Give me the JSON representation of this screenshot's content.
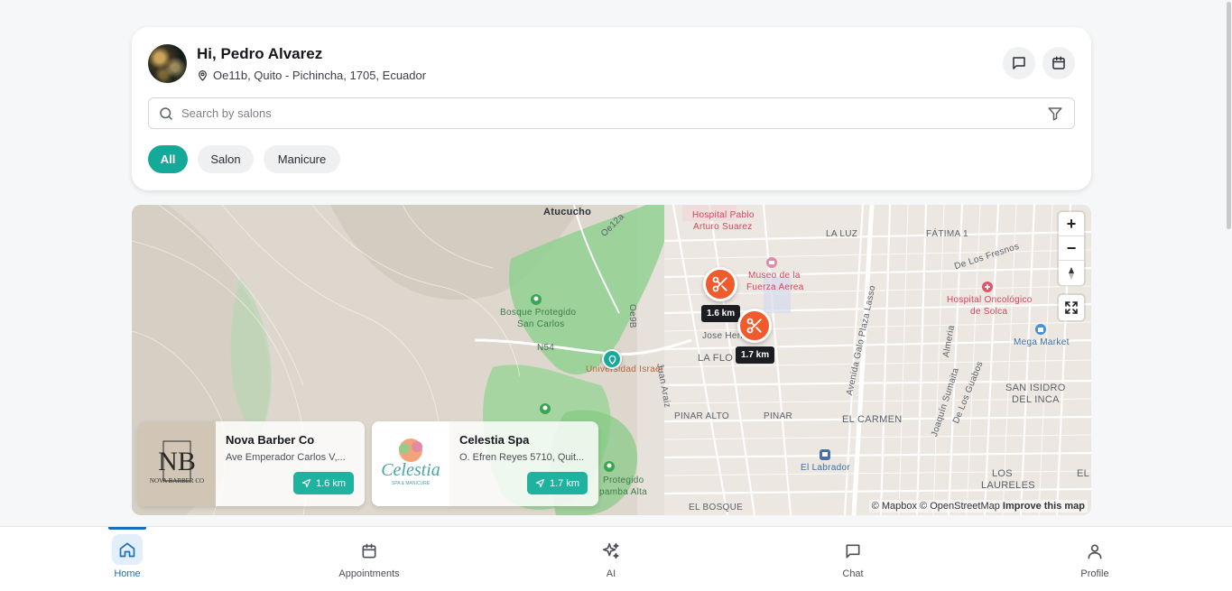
{
  "header": {
    "greeting": "Hi, Pedro Alvarez",
    "location": "Oe11b, Quito - Pichincha, 1705, Ecuador",
    "avatar_icon": "avatar",
    "messages_icon": "message-square-icon",
    "calendar_icon": "calendar-icon"
  },
  "search": {
    "placeholder": "Search by salons",
    "value": ""
  },
  "filters": {
    "chips": [
      {
        "label": "All",
        "active": true
      },
      {
        "label": "Salon",
        "active": false
      },
      {
        "label": "Manicure",
        "active": false
      }
    ]
  },
  "map": {
    "labels": {
      "atucucho": "Atucucho",
      "hospital_pablo_1": "Hospital Pablo",
      "hospital_pablo_2": "Arturo Suarez",
      "la_luz": "LA LUZ",
      "fatima": "FÁTIMA 1",
      "de_los_fresnos": "De Los Fresnos",
      "museo_1": "Museo de la",
      "museo_2": "Fuerza Aerea",
      "hospital_onco_1": "Hospital Oncológico",
      "hospital_onco_2": "de Solca",
      "bosque_1": "Bosque Protegido",
      "bosque_2": "San Carlos",
      "n54": "N54",
      "universidad": "Universidad Israel",
      "juan_araiz": "Juan Araiz",
      "jose_her": "Jose Herr",
      "la_flo": "LA FLO",
      "mega_market": "Mega Market",
      "avenida_galo": "Avenida Galo Plaza Lasso",
      "almeria": "Almeria",
      "san_isidro_1": "SAN ISIDRO",
      "san_isidro_2": "DEL INCA",
      "pinar_alto": "PINAR ALTO",
      "pinar": "PINAR",
      "el_carmen": "EL CARMEN",
      "joaquin": "Joaquín Sumaita",
      "de_los_guabos": "De Los Guabos",
      "el_labrador": "El Labrador",
      "los_laureles_1": "LOS",
      "los_laureles_2": "LAURELES",
      "el_bosque": "EL BOSQUE",
      "protegido_2": "Protegido",
      "pamba_alta": "pamba Alta",
      "oe12a": "Oe12a",
      "oe9b": "Oe9B",
      "el": "EL"
    },
    "pins": [
      {
        "distance": "1.6 km",
        "icon": "scissors-icon"
      },
      {
        "distance": "1.7 km",
        "icon": "scissors-icon"
      }
    ],
    "attribution": {
      "mapbox": "© Mapbox",
      "osm": "© OpenStreetMap",
      "improve": "Improve this map"
    },
    "controls": {
      "zoom_in": "+",
      "zoom_out": "−"
    }
  },
  "salons": [
    {
      "name": "Nova Barber Co",
      "address": "Ave Emperador Carlos V,...",
      "distance": "1.6 km"
    },
    {
      "name": "Celestia Spa",
      "address": "O. Efren Reyes 5710, Quit...",
      "distance": "1.7 km"
    }
  ],
  "nav": {
    "items": [
      {
        "label": "Home",
        "icon": "home-icon",
        "active": true
      },
      {
        "label": "Appointments",
        "icon": "calendar-icon",
        "active": false
      },
      {
        "label": "AI",
        "icon": "sparkles-icon",
        "active": false
      },
      {
        "label": "Chat",
        "icon": "message-square-icon",
        "active": false
      },
      {
        "label": "Profile",
        "icon": "user-icon",
        "active": false
      }
    ]
  },
  "colors": {
    "accent": "#15a99a",
    "pin": "#f05a2c",
    "nav_active": "#1d6fb5"
  }
}
